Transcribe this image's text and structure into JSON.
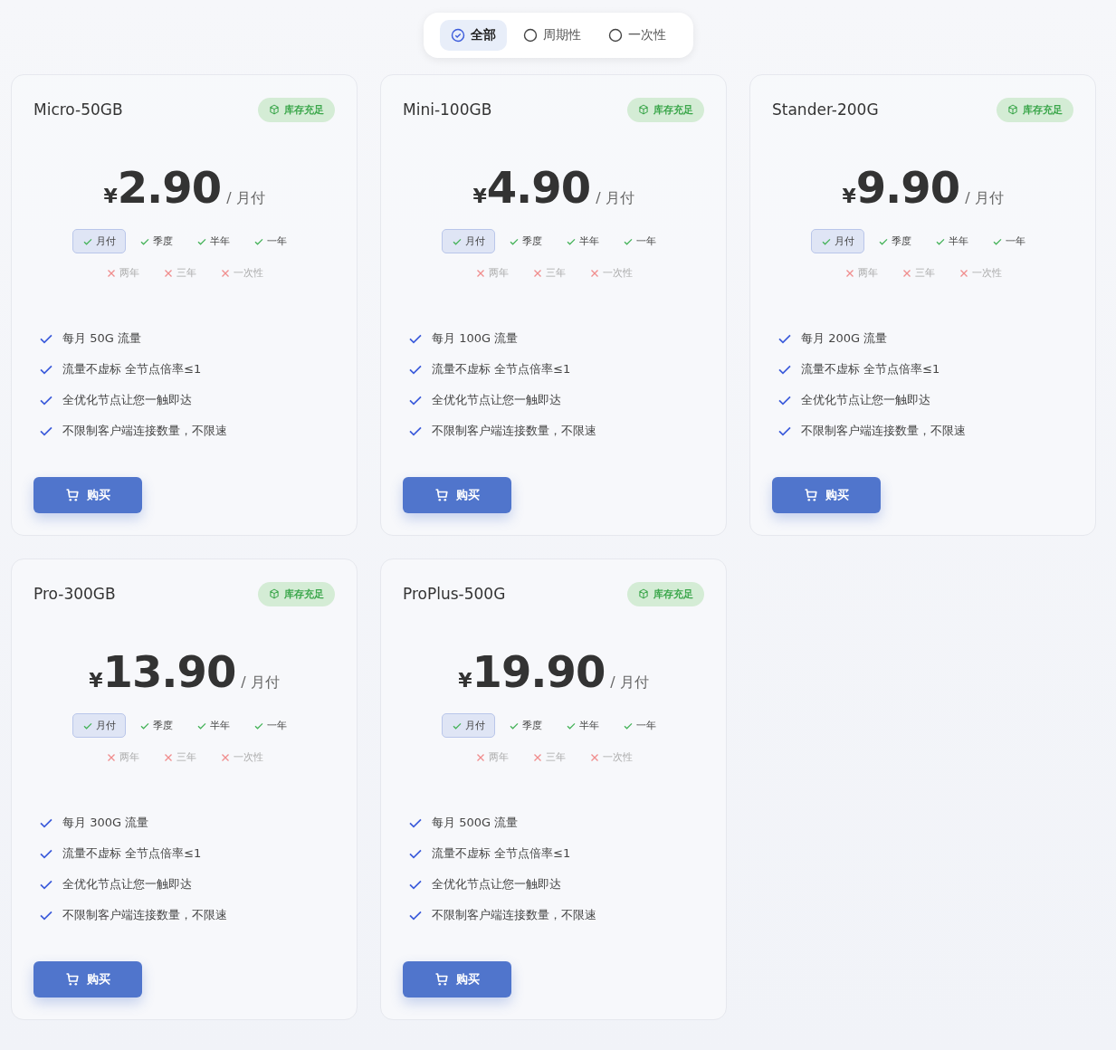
{
  "filter_tabs": [
    {
      "label": "全部",
      "selected": true
    },
    {
      "label": "周期性",
      "selected": false
    },
    {
      "label": "一次性",
      "selected": false
    }
  ],
  "plans": [
    {
      "name": "Micro-50GB",
      "badge": "库存充足",
      "currency": "¥",
      "price": "2.90",
      "unit": "/ 月付",
      "cycles": [
        {
          "label": "月付",
          "available": true,
          "selected": true
        },
        {
          "label": "季度",
          "available": true,
          "selected": false
        },
        {
          "label": "半年",
          "available": true,
          "selected": false
        },
        {
          "label": "一年",
          "available": true,
          "selected": false
        },
        {
          "label": "两年",
          "available": false,
          "selected": false
        },
        {
          "label": "三年",
          "available": false,
          "selected": false
        },
        {
          "label": "一次性",
          "available": false,
          "selected": false
        }
      ],
      "features": [
        "每月 50G 流量",
        "流量不虚标 全节点倍率≤1",
        "全优化节点让您一触即达",
        "不限制客户端连接数量，不限速"
      ],
      "buy": "购买"
    },
    {
      "name": "Mini-100GB",
      "badge": "库存充足",
      "currency": "¥",
      "price": "4.90",
      "unit": "/ 月付",
      "cycles": [
        {
          "label": "月付",
          "available": true,
          "selected": true
        },
        {
          "label": "季度",
          "available": true,
          "selected": false
        },
        {
          "label": "半年",
          "available": true,
          "selected": false
        },
        {
          "label": "一年",
          "available": true,
          "selected": false
        },
        {
          "label": "两年",
          "available": false,
          "selected": false
        },
        {
          "label": "三年",
          "available": false,
          "selected": false
        },
        {
          "label": "一次性",
          "available": false,
          "selected": false
        }
      ],
      "features": [
        "每月 100G 流量",
        "流量不虚标 全节点倍率≤1",
        "全优化节点让您一触即达",
        "不限制客户端连接数量，不限速"
      ],
      "buy": "购买"
    },
    {
      "name": "Stander-200G",
      "badge": "库存充足",
      "currency": "¥",
      "price": "9.90",
      "unit": "/ 月付",
      "cycles": [
        {
          "label": "月付",
          "available": true,
          "selected": true
        },
        {
          "label": "季度",
          "available": true,
          "selected": false
        },
        {
          "label": "半年",
          "available": true,
          "selected": false
        },
        {
          "label": "一年",
          "available": true,
          "selected": false
        },
        {
          "label": "两年",
          "available": false,
          "selected": false
        },
        {
          "label": "三年",
          "available": false,
          "selected": false
        },
        {
          "label": "一次性",
          "available": false,
          "selected": false
        }
      ],
      "features": [
        "每月 200G 流量",
        "流量不虚标 全节点倍率≤1",
        "全优化节点让您一触即达",
        "不限制客户端连接数量，不限速"
      ],
      "buy": "购买"
    },
    {
      "name": "Pro-300GB",
      "badge": "库存充足",
      "currency": "¥",
      "price": "13.90",
      "unit": "/ 月付",
      "cycles": [
        {
          "label": "月付",
          "available": true,
          "selected": true
        },
        {
          "label": "季度",
          "available": true,
          "selected": false
        },
        {
          "label": "半年",
          "available": true,
          "selected": false
        },
        {
          "label": "一年",
          "available": true,
          "selected": false
        },
        {
          "label": "两年",
          "available": false,
          "selected": false
        },
        {
          "label": "三年",
          "available": false,
          "selected": false
        },
        {
          "label": "一次性",
          "available": false,
          "selected": false
        }
      ],
      "features": [
        "每月 300G 流量",
        "流量不虚标 全节点倍率≤1",
        "全优化节点让您一触即达",
        "不限制客户端连接数量，不限速"
      ],
      "buy": "购买"
    },
    {
      "name": "ProPlus-500G",
      "badge": "库存充足",
      "currency": "¥",
      "price": "19.90",
      "unit": "/ 月付",
      "cycles": [
        {
          "label": "月付",
          "available": true,
          "selected": true
        },
        {
          "label": "季度",
          "available": true,
          "selected": false
        },
        {
          "label": "半年",
          "available": true,
          "selected": false
        },
        {
          "label": "一年",
          "available": true,
          "selected": false
        },
        {
          "label": "两年",
          "available": false,
          "selected": false
        },
        {
          "label": "三年",
          "available": false,
          "selected": false
        },
        {
          "label": "一次性",
          "available": false,
          "selected": false
        }
      ],
      "features": [
        "每月 500G 流量",
        "流量不虚标 全节点倍率≤1",
        "全优化节点让您一触即达",
        "不限制客户端连接数量，不限速"
      ],
      "buy": "购买"
    }
  ]
}
